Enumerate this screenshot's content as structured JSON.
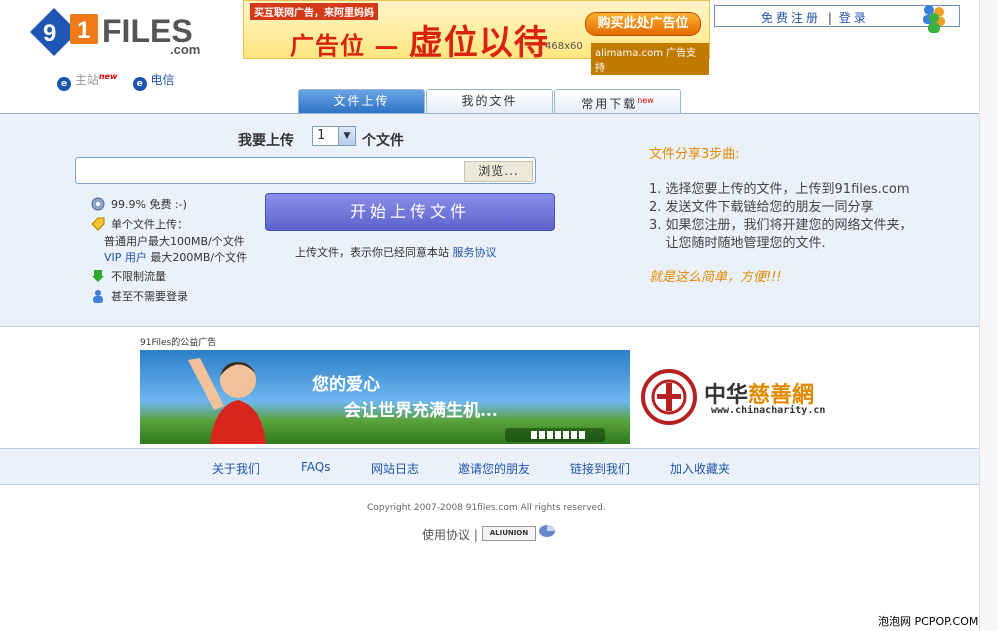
{
  "brand": {
    "logo_left": "9",
    "logo_mid": "1",
    "logo_text": "FILES",
    "logo_sub": ".com"
  },
  "ad": {
    "top_text": "买互联网广告，来阿里妈妈",
    "main_a": "广告位",
    "main_dash": " — ",
    "main_b": "虚位以待",
    "buy": "购买此处广告位",
    "size": "468x60",
    "ali": "alimama.com 广告支持"
  },
  "account": {
    "register": "免费注册",
    "sep": "|",
    "login": "登录"
  },
  "telecom": {
    "main": "主站",
    "new": "new",
    "tel": "电信"
  },
  "tabs": [
    {
      "label": "文件上传"
    },
    {
      "label": "我的文件"
    },
    {
      "label": "常用下载",
      "badge": "new"
    }
  ],
  "upload": {
    "label": "我要上传",
    "count": "1",
    "unit": "个文件",
    "browse": "浏览...",
    "start": "开始上传文件",
    "agree": "上传文件，表示你已经同意本站",
    "agree_link": "服务协议"
  },
  "features": {
    "free": "99.9% 免费  :-)",
    "single": "单个文件上传：",
    "normal": "普通用户最大100MB/个文件",
    "vip_link": "VIP 用户",
    "vip_rest": " 最大200MB/个文件",
    "traffic": "不限制流量",
    "nologin": "甚至不需要登录"
  },
  "steps": {
    "title": "文件分享3步曲:",
    "items": [
      "1. 选择您要上传的文件，上传到91files.com",
      "2. 发送文件下载链给您的朋友一同分享",
      "3. 如果您注册，我们将开建您的网络文件夹，",
      "    让您随时随地管理您的文件."
    ],
    "slogan": "就是这么简单，方便!!!"
  },
  "charity": {
    "label": "91Files的公益广告",
    "slogan1": "您的爱心",
    "slogan2": "会让世界充满生机...",
    "name_a": "中华",
    "name_b": "慈善網",
    "url": "www.chinacharity.cn"
  },
  "footer": {
    "links": [
      "关于我们",
      "FAQs",
      "网站日志",
      "邀请您的朋友",
      "链接到我们",
      "加入收藏夹"
    ],
    "copyright": "Copyright 2007-2008 91files.com All rights reserved.",
    "terms": "使用协议",
    "sep": "|",
    "badge": "ALIUNION"
  },
  "watermark": "泡泡网 PCPOP.COM",
  "colors": {
    "accent": "#2d72c4",
    "orange": "#e08a00",
    "button": "#5e63cc",
    "panel": "#eaf1f9"
  }
}
